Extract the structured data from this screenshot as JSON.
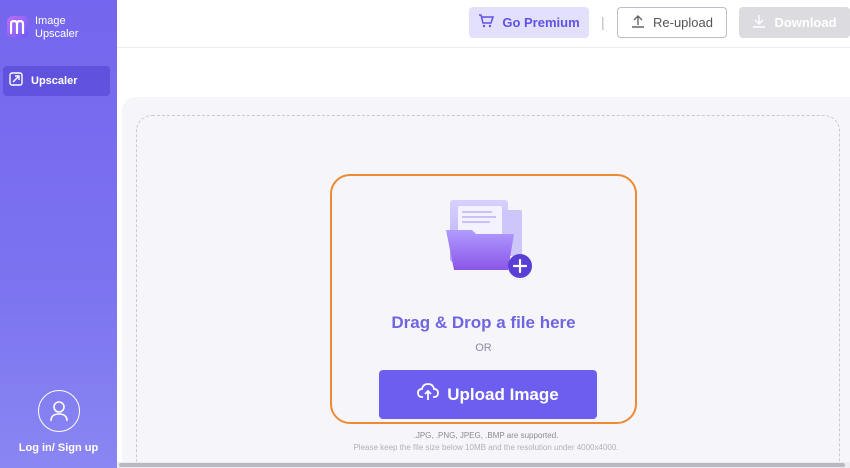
{
  "app": {
    "name_line1": "Image",
    "name_line2": "Upscaler"
  },
  "sidebar": {
    "items": [
      {
        "label": "Upscaler",
        "icon": "upscale-icon"
      }
    ],
    "login_label": "Log in/ Sign up"
  },
  "toolbar": {
    "premium_label": "Go Premium",
    "separator": "|",
    "reupload_label": "Re-upload",
    "download_label": "Download"
  },
  "upload": {
    "drag_text": "Drag & Drop a file here",
    "or_text": "OR",
    "button_label": "Upload Image",
    "formats_text": ".JPG, .PNG, JPEG, .BMP are supported.",
    "note_text": "Please keep the file size below 10MB and the resolution under 4000x4000."
  },
  "colors": {
    "accent": "#6c5ff0",
    "sidebar": "#7466ee",
    "highlight_border": "#ec8a35"
  }
}
